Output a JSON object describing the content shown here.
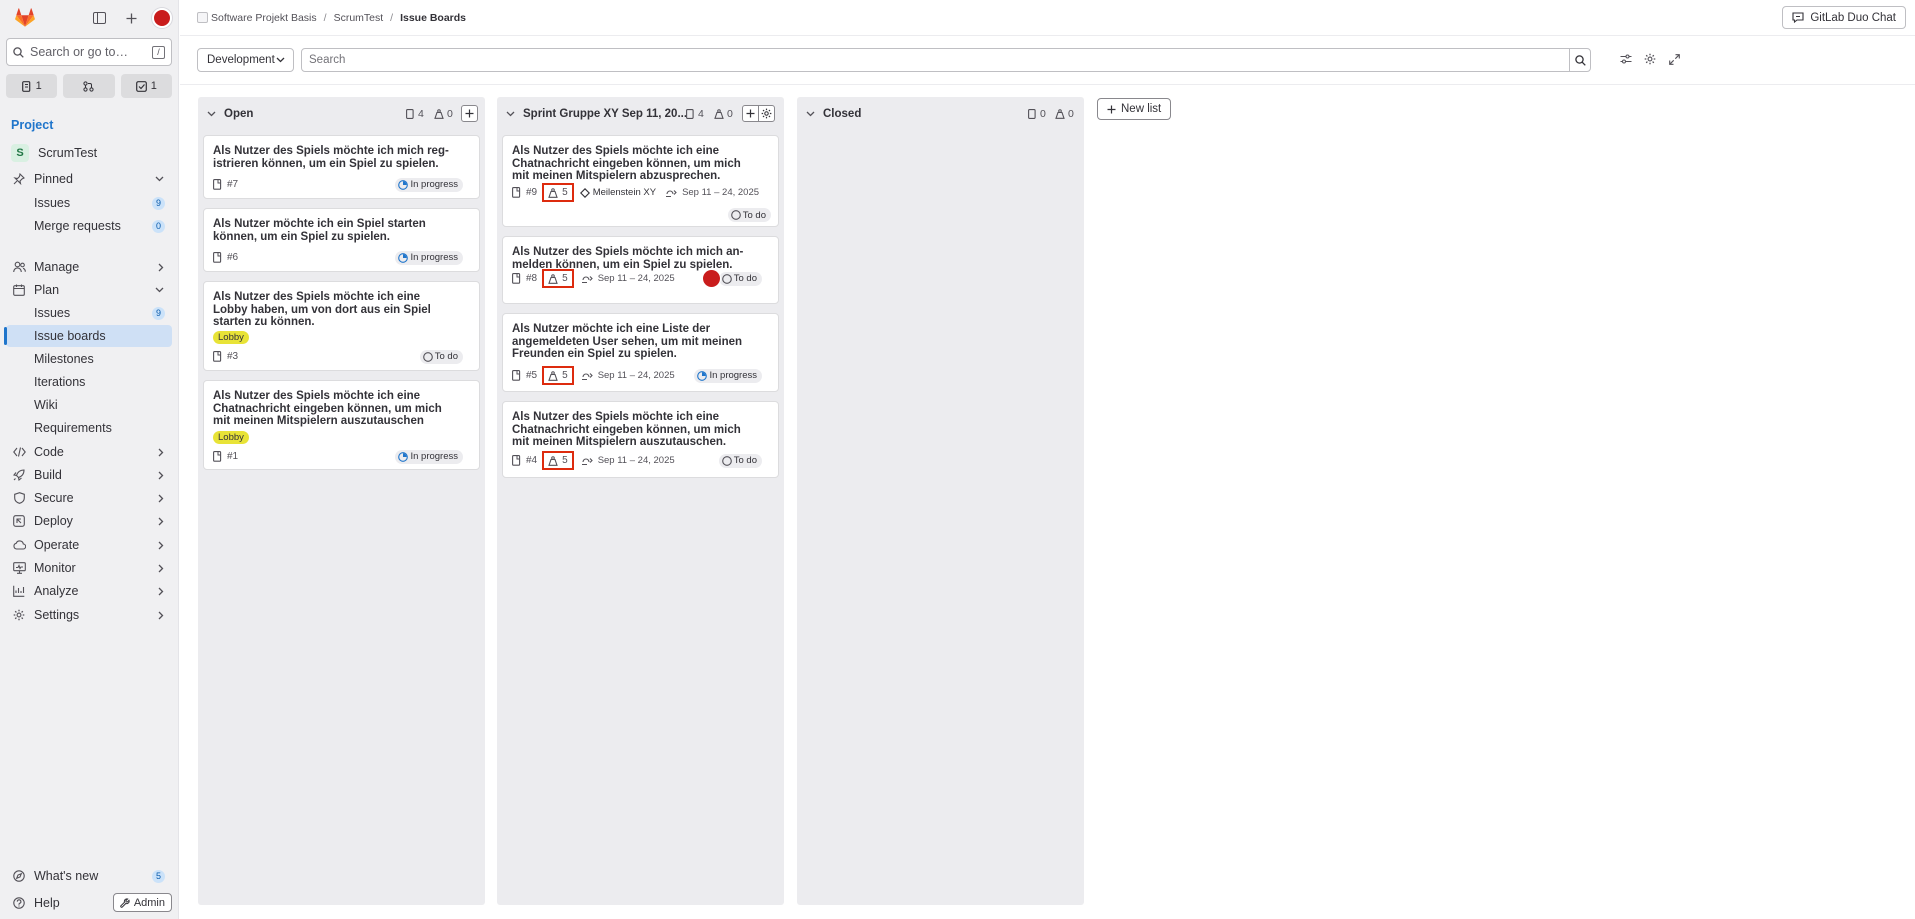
{
  "sidebar": {
    "search_placeholder": "Search or go to…",
    "search_shortcut": "/",
    "counters": [
      {
        "icon": "issues-icon",
        "value": "1"
      },
      {
        "icon": "merge-request-icon",
        "value": ""
      },
      {
        "icon": "todo-icon",
        "value": "1"
      }
    ],
    "section_title": "Project",
    "project": {
      "avatar_letter": "S",
      "name": "ScrumTest"
    },
    "pinned": {
      "label": "Pinned",
      "items": [
        {
          "label": "Issues",
          "badge": "9"
        },
        {
          "label": "Merge requests",
          "badge": "0"
        }
      ]
    },
    "manage": "Manage",
    "plan": {
      "label": "Plan",
      "items": [
        {
          "label": "Issues",
          "badge": "9"
        },
        {
          "label": "Issue boards"
        },
        {
          "label": "Milestones"
        },
        {
          "label": "Iterations"
        },
        {
          "label": "Wiki"
        },
        {
          "label": "Requirements"
        }
      ]
    },
    "groups": [
      "Code",
      "Build",
      "Secure",
      "Deploy",
      "Operate",
      "Monitor",
      "Analyze",
      "Settings"
    ],
    "whats_new": {
      "label": "What's new",
      "badge": "5"
    },
    "help": "Help",
    "admin": "Admin"
  },
  "breadcrumb": [
    "Software Projekt Basis",
    "ScrumTest",
    "Issue Boards"
  ],
  "header": {
    "duo_chat": "GitLab Duo Chat"
  },
  "filter": {
    "board": "Development",
    "search_placeholder": "Search"
  },
  "board": {
    "new_list": "New list",
    "lists": [
      {
        "title": "Open",
        "issues": "4",
        "weight": "0",
        "cards": [
          {
            "title": "Als Nutzer des Spiels möchte ich mich reg­istrieren können, um ein Spiel zu spielen.",
            "iid": "#7",
            "status": "In progress"
          },
          {
            "title": "Als Nutzer möchte ich ein Spiel starten können, um ein Spiel zu spielen.",
            "iid": "#6",
            "status": "In progress"
          },
          {
            "title": "Als Nutzer des Spiels möchte ich eine Lobby haben, um von dort aus ein Spiel starten zu können.",
            "label": "Lobby",
            "iid": "#3",
            "status": "To do"
          },
          {
            "title": "Als Nutzer des Spiels möchte ich eine Chatnachricht eingeben können, um mich mit meinen Mitspielern auszutauschen",
            "label": "Lobby",
            "iid": "#1",
            "status": "In progress"
          }
        ]
      },
      {
        "title": "Sprint Gruppe XY Sep 11, 20...",
        "issues": "4",
        "weight": "0",
        "cards": [
          {
            "title": "Als Nutzer des Spiels möchte ich eine Chatnachricht eingeben können, um mich mit meinen Mitspielern abzusprechen.",
            "iid": "#9",
            "weight": "5",
            "milestone": "Meilenstein XY",
            "date": "Sep 11 – 24, 2025",
            "status": "To do"
          },
          {
            "title": "Als Nutzer des Spiels möchte ich mich an­melden können, um ein Spiel zu spielen.",
            "iid": "#8",
            "weight": "5",
            "date": "Sep 11 – 24, 2025",
            "status": "To do"
          },
          {
            "title": "Als Nutzer möchte ich eine Liste der angemeldeten User sehen, um mit meinen Freunden ein Spiel zu spielen.",
            "iid": "#5",
            "weight": "5",
            "date": "Sep 11 – 24, 2025",
            "status": "In progress"
          },
          {
            "title": "Als Nutzer des Spiels möchte ich eine Chatnachricht eingeben können, um mich mit meinen Mitspielern auszutauschen.",
            "iid": "#4",
            "weight": "5",
            "date": "Sep 11 – 24, 2025",
            "status": "To do"
          }
        ]
      },
      {
        "title": "Closed",
        "issues": "0",
        "weight": "0",
        "cards": []
      }
    ]
  },
  "colors": {
    "accent": "#1f75cb",
    "label_lobby": "#e8e337",
    "highlight": "#dd2b0e",
    "in_progress": "#1f75cb"
  }
}
